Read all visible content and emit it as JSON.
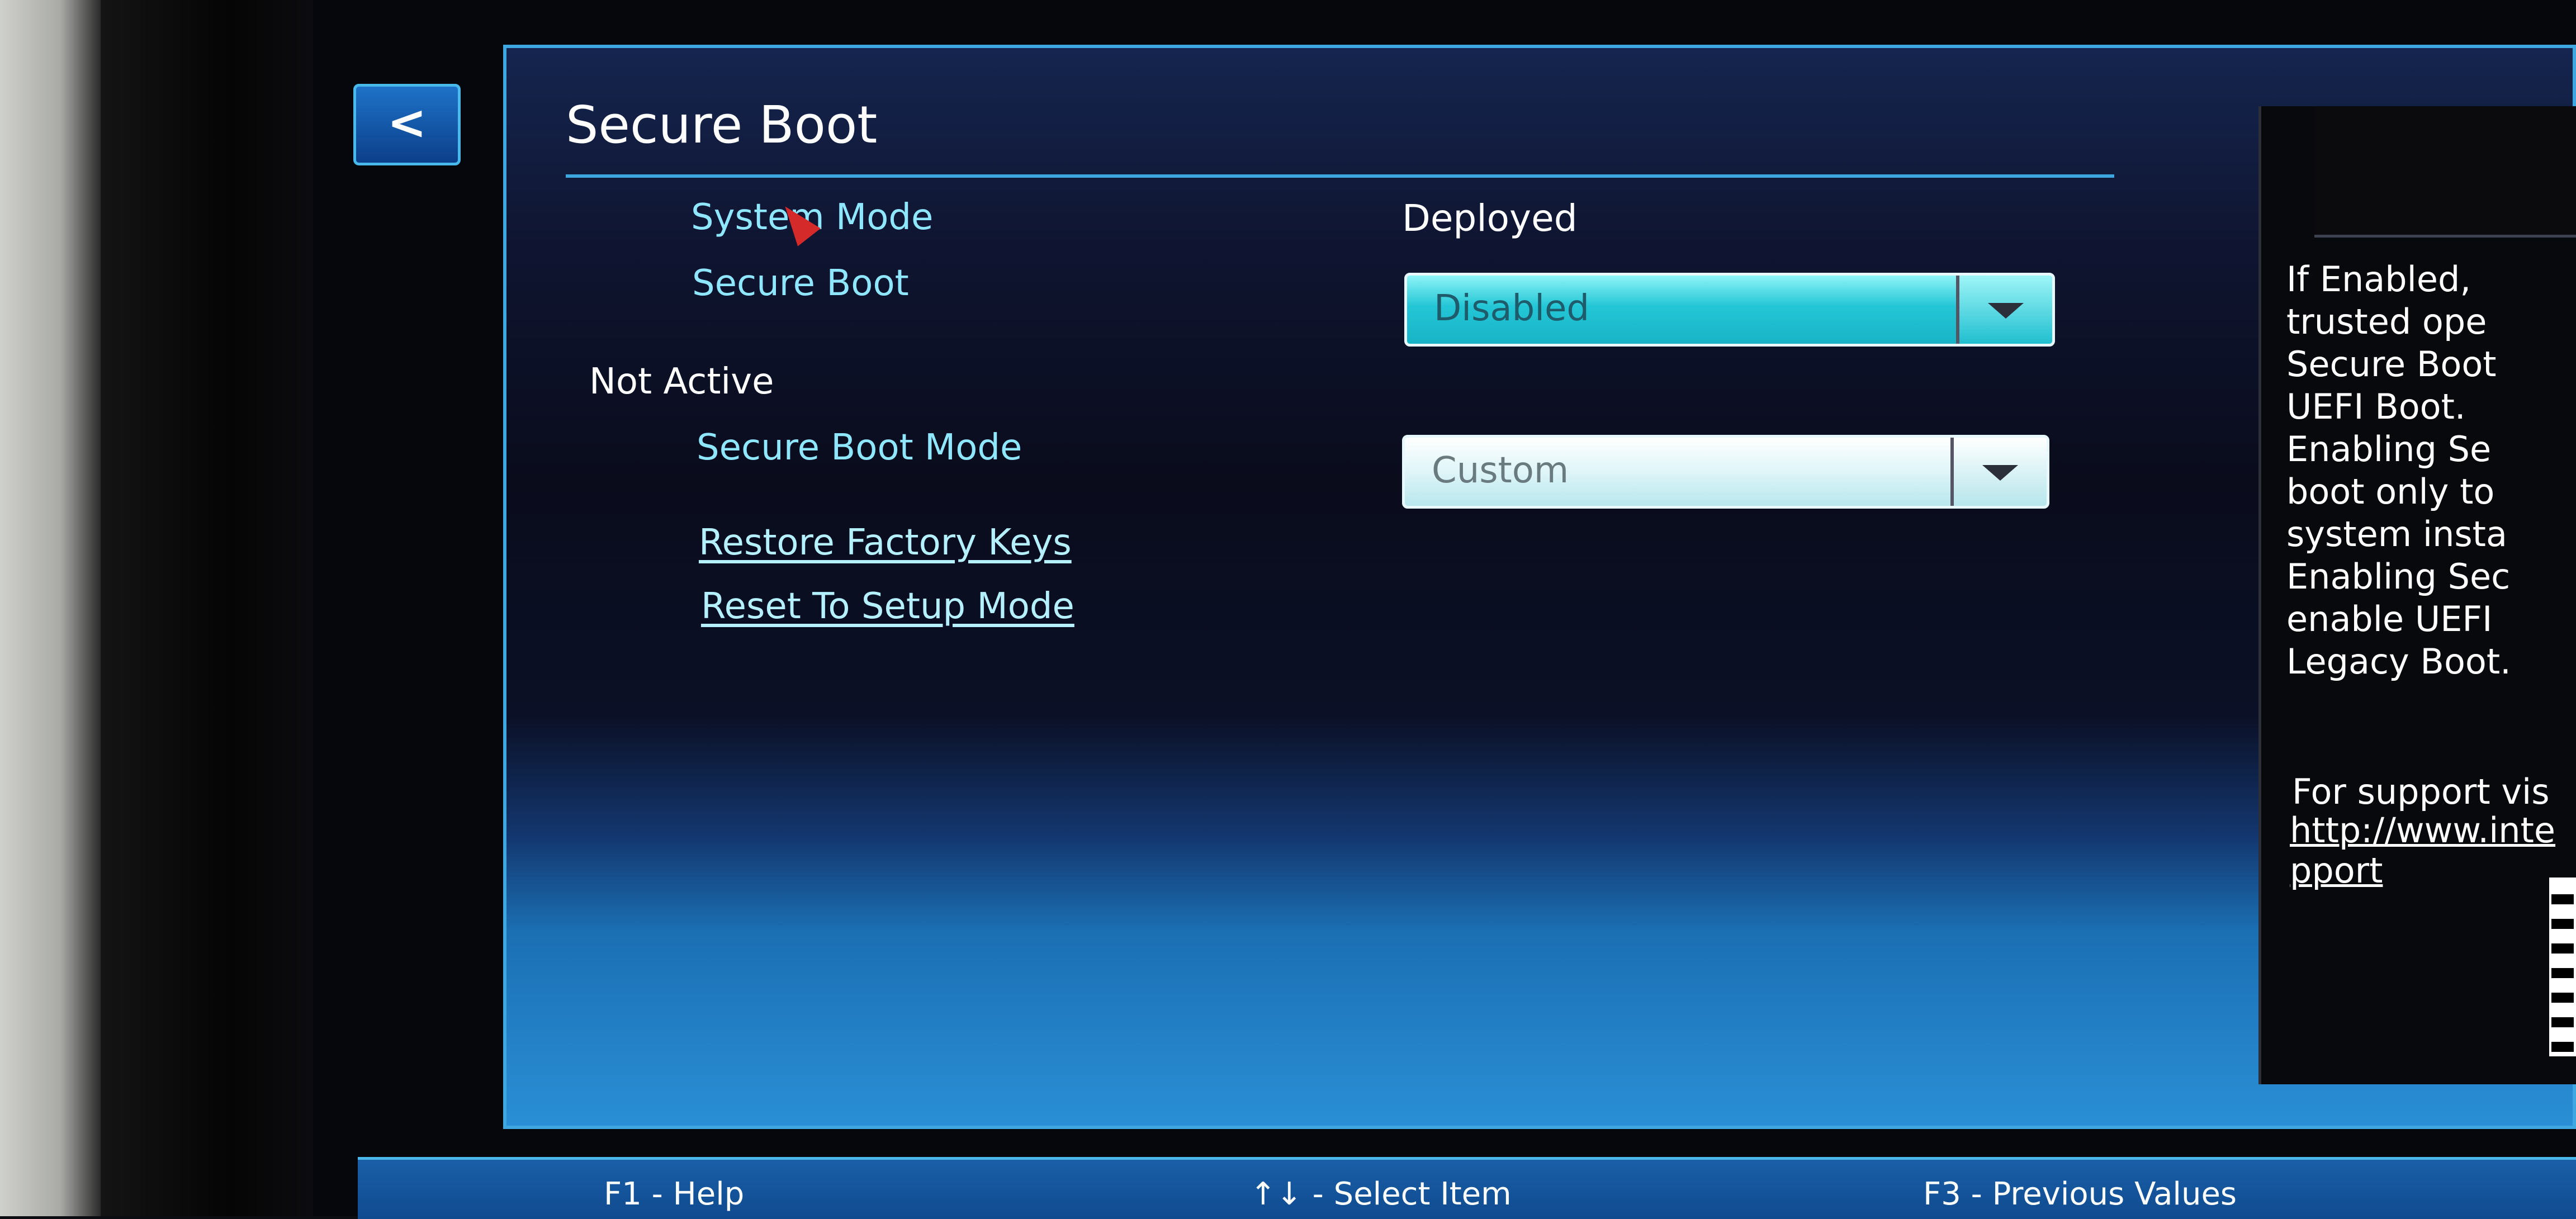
{
  "nav": {
    "back_label": "<"
  },
  "page": {
    "title": "Secure Boot"
  },
  "settings": {
    "system_mode": {
      "label": "System Mode",
      "value": "Deployed"
    },
    "secure_boot": {
      "label": "Secure Boot",
      "value": "Disabled"
    },
    "status_heading": "Not Active",
    "secure_boot_mode": {
      "label": "Secure Boot Mode",
      "value": "Custom"
    },
    "restore_factory_keys": "Restore Factory Keys",
    "reset_to_setup_mode": "Reset To Setup Mode"
  },
  "help": {
    "text": "If Enabled,\ntrusted ope\nSecure Boot\nUEFI Boot.\nEnabling Se\nboot only to\nsystem insta\nEnabling Sec\nenable UEFI\nLegacy Boot.",
    "support_label": "For support vis",
    "support_link": "http://www.inte\npport"
  },
  "footer": {
    "help": "F1 - Help",
    "select_item": "↑↓ - Select Item",
    "previous_values": "F3 - Previous Values"
  },
  "colors": {
    "accent": "#3fa7e0",
    "label_cyan": "#8fe6ff",
    "dropdown_active": "#23c6d6",
    "cursor": "#d42a2a"
  },
  "icons": [
    "back-arrow-icon",
    "chevron-down-icon",
    "mouse-cursor-icon",
    "qr-code-icon"
  ]
}
